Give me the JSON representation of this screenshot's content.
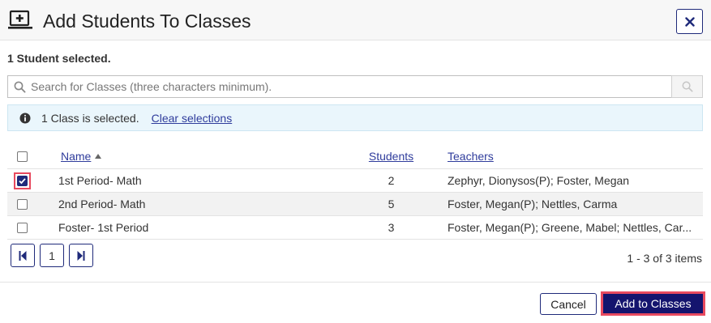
{
  "dialog": {
    "title": "Add Students To Classes",
    "icon": "add-to-classroom-icon",
    "close_icon": "close-icon"
  },
  "selection": {
    "students_text": "1 Student selected."
  },
  "search": {
    "placeholder": "Search for Classes (three characters minimum).",
    "value": "",
    "icon": "search-icon"
  },
  "info_bar": {
    "icon": "info-icon",
    "text": "1 Class is selected.",
    "clear_link": "Clear selections"
  },
  "table": {
    "columns": {
      "name": "Name",
      "students": "Students",
      "teachers": "Teachers"
    },
    "sort": {
      "column": "name",
      "direction": "ascending"
    },
    "rows": [
      {
        "checked": true,
        "name": "1st Period- Math",
        "students": "2",
        "teachers": "Zephyr, Dionysos(P); Foster, Megan"
      },
      {
        "checked": false,
        "name": "2nd Period- Math",
        "students": "5",
        "teachers": "Foster, Megan(P); Nettles, Carma"
      },
      {
        "checked": false,
        "name": "Foster- 1st Period",
        "students": "3",
        "teachers": "Foster, Megan(P); Greene, Mabel; Nettles, Car..."
      }
    ]
  },
  "pager": {
    "first_icon": "first-page-icon",
    "page": "1",
    "last_icon": "last-page-icon",
    "info": "1 - 3 of 3 items"
  },
  "footer": {
    "cancel_label": "Cancel",
    "add_label": "Add to Classes"
  },
  "colors": {
    "accent": "#1f2a7a",
    "primary_button": "#14146e",
    "highlight": "#e84a5f",
    "info_background": "#eaf6fc"
  }
}
